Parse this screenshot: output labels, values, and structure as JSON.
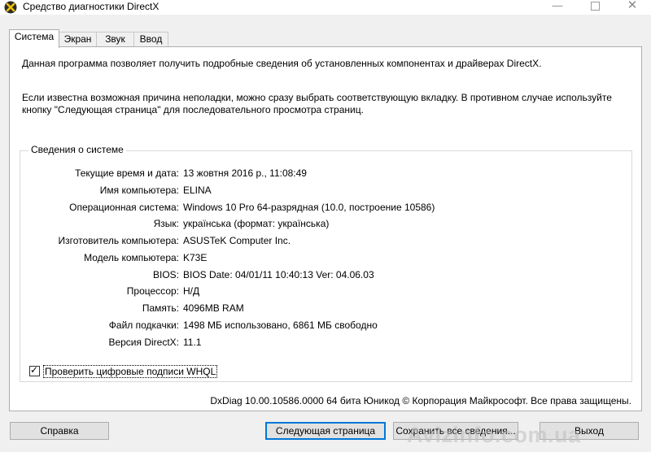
{
  "window": {
    "title": "Средство диагностики DirectX",
    "minimize_glyph": "—",
    "close_glyph": "✕"
  },
  "tabs": [
    {
      "label": "Система",
      "active": true
    },
    {
      "label": "Экран",
      "active": false
    },
    {
      "label": "Звук",
      "active": false
    },
    {
      "label": "Ввод",
      "active": false
    }
  ],
  "intro": {
    "line1": "Данная программа позволяет получить подробные сведения об установленных компонентах и драйверах DirectX.",
    "line2": "Если известна возможная причина неполадки, можно сразу выбрать соответствующую вкладку. В противном случае используйте кнопку \"Следующая страница\" для последовательного просмотра страниц."
  },
  "system_info": {
    "title": "Сведения о системе",
    "rows": [
      {
        "label": "Текущие время и дата:",
        "value": "13 жовтня 2016 р., 11:08:49"
      },
      {
        "label": "Имя компьютера:",
        "value": "ELINA"
      },
      {
        "label": "Операционная система:",
        "value": "Windows 10 Pro 64-разрядная (10.0, построение 10586)"
      },
      {
        "label": "Язык:",
        "value": "українська (формат: українська)"
      },
      {
        "label": "Изготовитель компьютера:",
        "value": "ASUSTeK Computer Inc."
      },
      {
        "label": "Модель компьютера:",
        "value": "K73E"
      },
      {
        "label": "BIOS:",
        "value": "BIOS Date: 04/01/11 10:40:13 Ver: 04.06.03"
      },
      {
        "label": "Процессор:",
        "value": "Н/Д"
      },
      {
        "label": "Память:",
        "value": "4096MB RAM"
      },
      {
        "label": "Файл подкачки:",
        "value": "1498 МБ использовано, 6861 МБ свободно"
      },
      {
        "label": "Версия DirectX:",
        "value": "11.1"
      }
    ]
  },
  "whql": {
    "label": "Проверить цифровые подписи WHQL",
    "checked": true,
    "check_glyph": "✓"
  },
  "footer_text": "DxDiag 10.00.10586.0000 64 бита Юникод  © Корпорация Майкрософт. Все права защищены.",
  "buttons": {
    "help": "Справка",
    "next": "Следующая страница",
    "save": "Сохранить все сведения...",
    "exit": "Выход"
  },
  "watermark": "Avizinfo.com.ua",
  "colors": {
    "accent": "#0078d7",
    "panel": "#ffffff",
    "window": "#f0f0f0"
  }
}
